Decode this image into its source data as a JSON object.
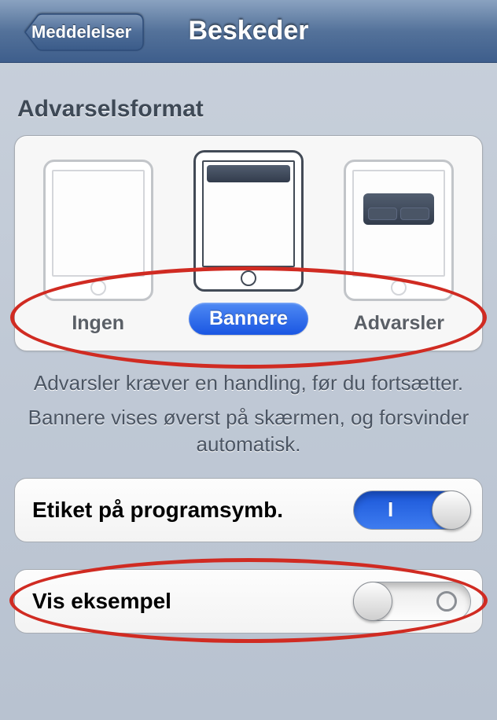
{
  "nav": {
    "back_label": "Meddelelser",
    "title": "Beskeder"
  },
  "alertStyle": {
    "header": "Advarselsformat",
    "options": [
      {
        "label": "Ingen",
        "selected": false
      },
      {
        "label": "Bannere",
        "selected": true
      },
      {
        "label": "Advarsler",
        "selected": false
      }
    ]
  },
  "help": {
    "line1": "Advarsler kræver en handling, før du fortsætter.",
    "line2": "Bannere vises øverst på skærmen, og forsvinder automatisk."
  },
  "settings": {
    "badge": {
      "label": "Etiket på programsymb.",
      "on": true,
      "on_text": "I"
    },
    "preview": {
      "label": "Vis eksempel",
      "on": false
    }
  },
  "colors": {
    "accent": "#1a56e2",
    "annotation": "#d02b22"
  }
}
